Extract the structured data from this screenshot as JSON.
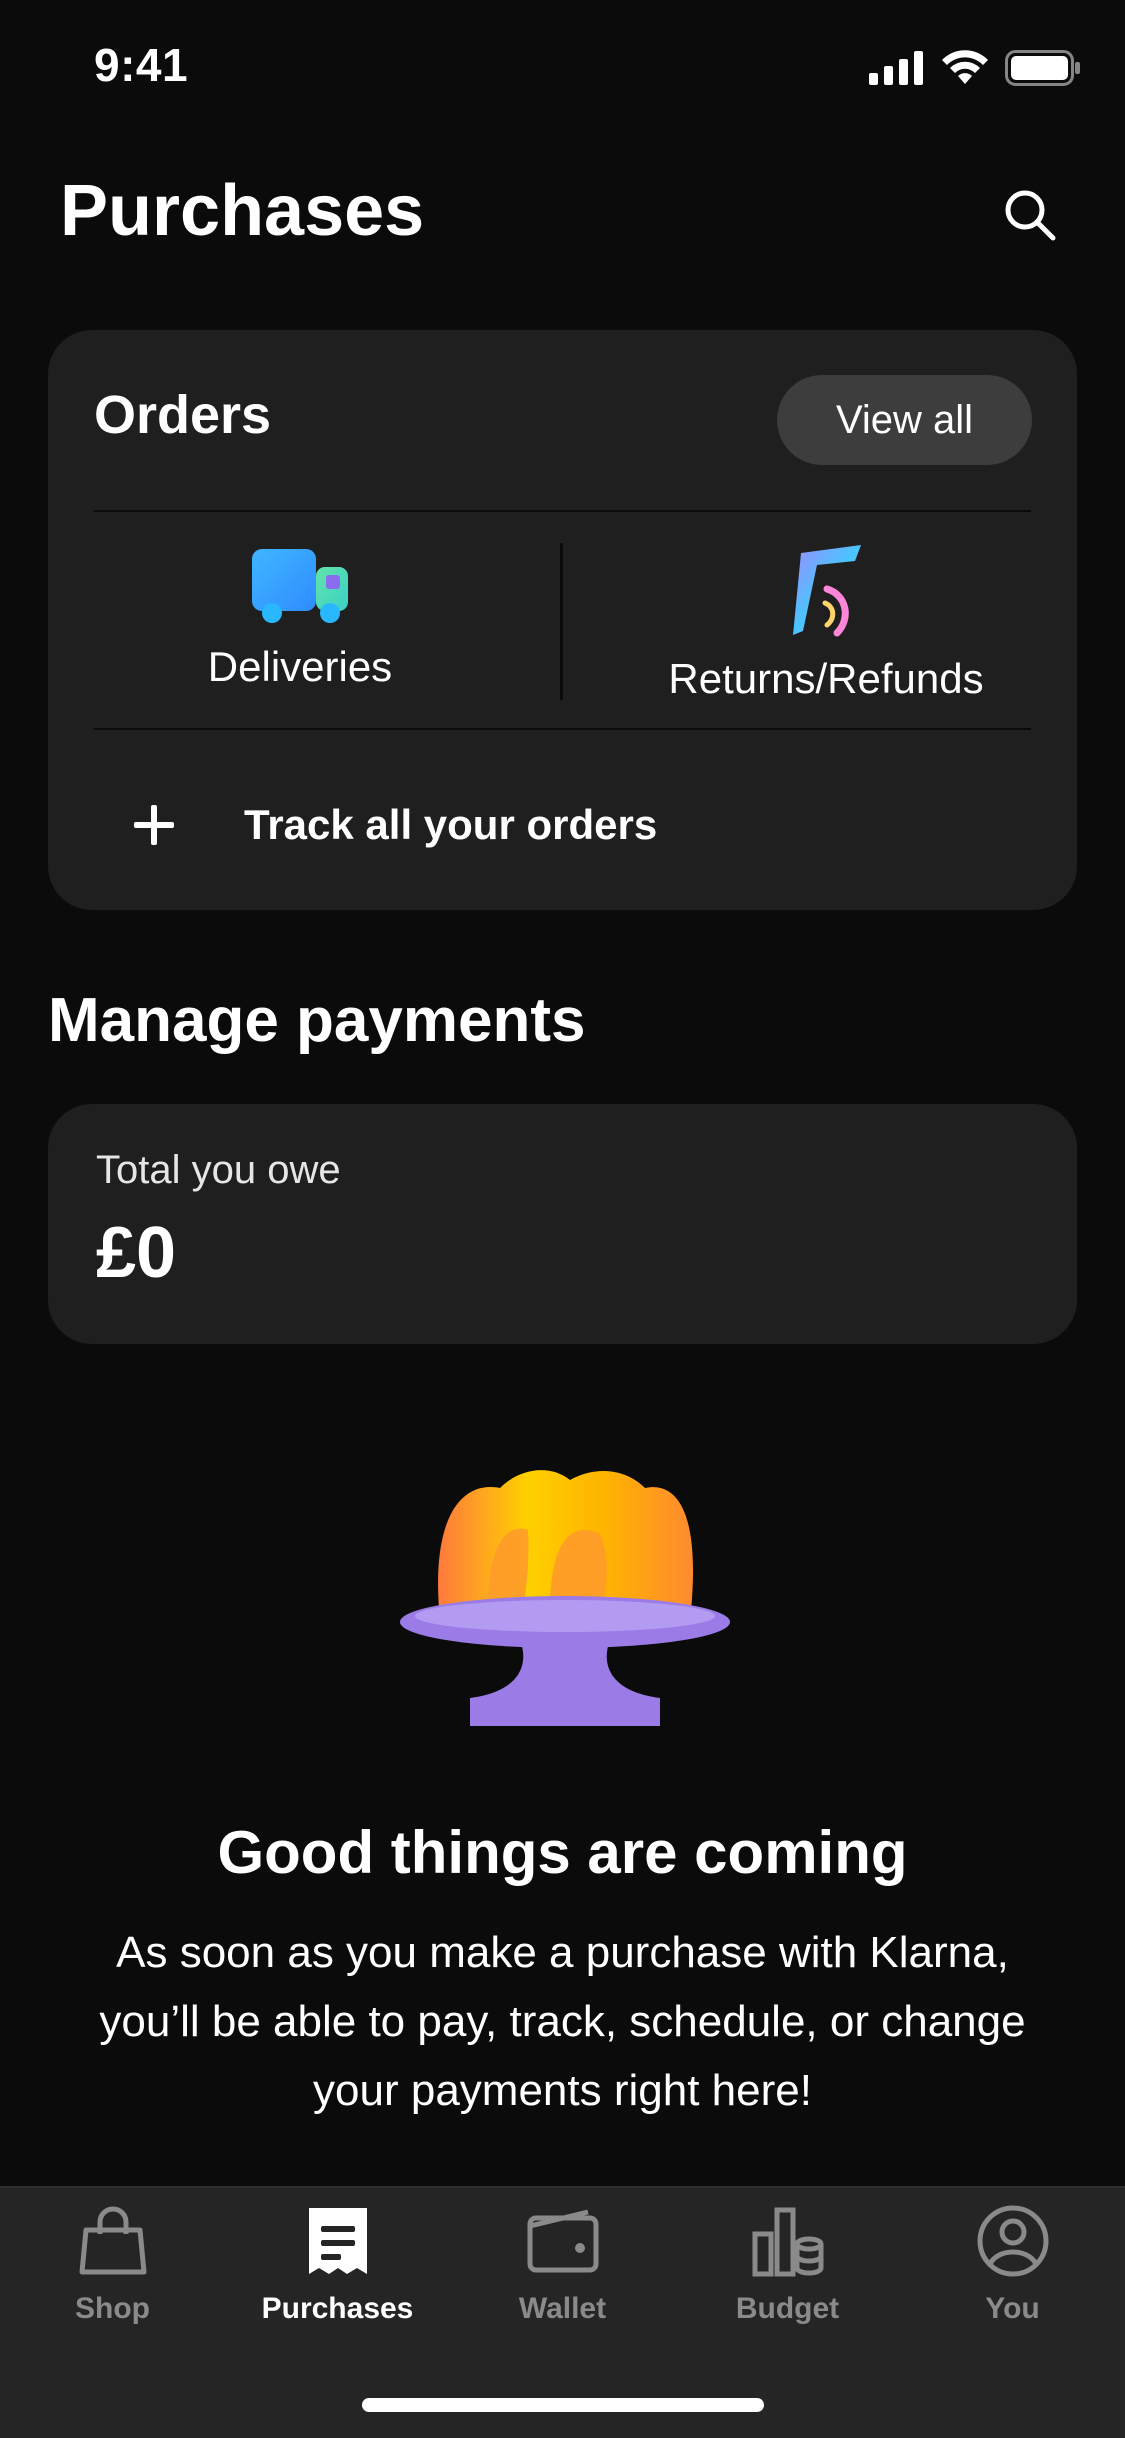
{
  "status_bar": {
    "time": "9:41"
  },
  "header": {
    "title": "Purchases",
    "search_icon": "search-icon"
  },
  "orders": {
    "title": "Orders",
    "view_all_label": "View all",
    "tiles": [
      {
        "label": "Deliveries",
        "icon": "delivery-truck-icon"
      },
      {
        "label": "Returns/Refunds",
        "icon": "boomerang-icon"
      }
    ],
    "track_label": "Track all your orders"
  },
  "payments": {
    "section_title": "Manage payments",
    "owe_label": "Total you owe",
    "owe_amount": "£0"
  },
  "empty_state": {
    "illustration": "jelly-cake-illustration",
    "title": "Good things are coming",
    "body": "As soon as you make a purchase with Klarna, you’ll be able to pay, track, schedule, or change your payments right here!"
  },
  "tabbar": {
    "items": [
      {
        "label": "Shop",
        "icon": "shopping-bag-icon",
        "active": false
      },
      {
        "label": "Purchases",
        "icon": "receipt-icon",
        "active": true
      },
      {
        "label": "Wallet",
        "icon": "wallet-icon",
        "active": false
      },
      {
        "label": "Budget",
        "icon": "budget-chart-icon",
        "active": false
      },
      {
        "label": "You",
        "icon": "profile-icon",
        "active": false
      }
    ]
  },
  "colors": {
    "background": "#0b0b0b",
    "card": "#1f1f1f",
    "tabbar": "#252525",
    "inactive_tab": "#8a8a8a"
  }
}
